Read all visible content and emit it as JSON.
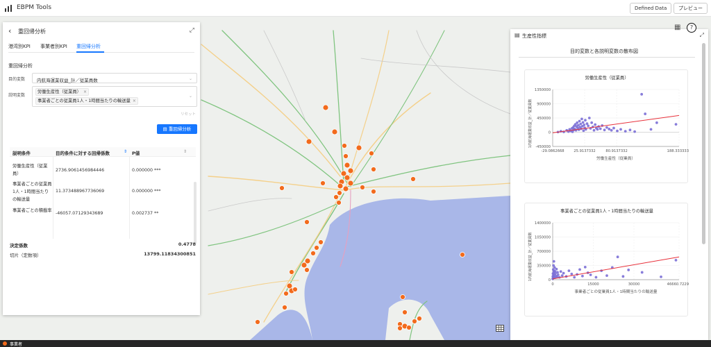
{
  "header": {
    "app_title": "EBPM Tools",
    "defined_data_label": "Defined Data",
    "preview_label": "プレビュー"
  },
  "left_panel": {
    "title": "重回帰分析",
    "tabs": [
      {
        "label": "港湾別KPI"
      },
      {
        "label": "事業者別KPI"
      },
      {
        "label": "重回帰分析"
      }
    ],
    "active_tab": "重回帰分析",
    "section_title": "重回帰分析",
    "objective_label": "目的変数",
    "objective_value": "内航海運業収益_計／従業員数",
    "explanatory_label": "説明変数",
    "explanatory_tags": [
      {
        "text": "労働生産性（従業員）"
      },
      {
        "text": "事業者ごとの従業員1人・1時間当たりの輸送量"
      }
    ],
    "reset_label": "リセット",
    "run_button_label": "重回帰分析",
    "table": {
      "headers": [
        "説明条件",
        "目的条件に対する回帰係数",
        "P値"
      ],
      "rows": [
        {
          "name": "労働生産性（従業員）",
          "coef": "2736.9061456984446",
          "p": "0.000000 ***"
        },
        {
          "name": "事業者ごとの従業員1人・1時間当たりの輸送量",
          "coef": "11.373488967736069",
          "p": "0.000000 ***"
        },
        {
          "name": "事業者ごとの積載率",
          "coef": "-46057.07129343689",
          "p": "0.002737 **"
        }
      ],
      "r2_label": "決定係数",
      "r2_value": "0.4778",
      "intercept_label": "切片（定数項）",
      "intercept_value": "13799.11834300851"
    }
  },
  "right_panel": {
    "title": "生産性指標",
    "subtitle": "目的変数と各説明変数の散布図"
  },
  "chart_data": [
    {
      "type": "scatter",
      "title": "労働生産性（従業員）",
      "xlabel": "労働生産性（従業員）",
      "ylabel": "1内航海運業収益_計／従業員数",
      "xticks": [
        "-29.0862668",
        "25.9137332",
        "80.9137332",
        "188.3333333"
      ],
      "yticks": [
        "1350000",
        "900000",
        "450000",
        "0",
        "-450000"
      ],
      "xlim": [
        -29.0862668,
        188.3333333
      ],
      "ylim": [
        -450000,
        1350000
      ],
      "point_color": "#7b6fd6",
      "line_color": "#e8303a",
      "regression": {
        "x": [
          -29.0862668,
          188.3333333
        ],
        "y": [
          -20000,
          530000
        ]
      },
      "points": [
        {
          "x": -20,
          "y": 5000
        },
        {
          "x": -15,
          "y": 30000
        },
        {
          "x": -10,
          "y": 10000
        },
        {
          "x": -5,
          "y": 60000
        },
        {
          "x": -2,
          "y": 20000
        },
        {
          "x": 0,
          "y": 90000
        },
        {
          "x": 2,
          "y": 40000
        },
        {
          "x": 4,
          "y": 120000
        },
        {
          "x": 5,
          "y": 15000
        },
        {
          "x": 6,
          "y": 150000
        },
        {
          "x": 7,
          "y": 70000
        },
        {
          "x": 8,
          "y": 200000
        },
        {
          "x": 9,
          "y": 100000
        },
        {
          "x": 10,
          "y": 250000
        },
        {
          "x": 11,
          "y": 60000
        },
        {
          "x": 12,
          "y": 180000
        },
        {
          "x": 13,
          "y": 300000
        },
        {
          "x": 14,
          "y": 130000
        },
        {
          "x": 15,
          "y": 220000
        },
        {
          "x": 16,
          "y": 80000
        },
        {
          "x": 17,
          "y": 350000
        },
        {
          "x": 18,
          "y": 160000
        },
        {
          "x": 19,
          "y": 260000
        },
        {
          "x": 20,
          "y": 110000
        },
        {
          "x": 21,
          "y": 420000
        },
        {
          "x": 22,
          "y": 190000
        },
        {
          "x": 23,
          "y": 310000
        },
        {
          "x": 24,
          "y": 50000
        },
        {
          "x": 25,
          "y": 230000
        },
        {
          "x": 26,
          "y": 140000
        },
        {
          "x": 27,
          "y": 380000
        },
        {
          "x": 28,
          "y": 90000
        },
        {
          "x": 30,
          "y": 270000
        },
        {
          "x": 32,
          "y": 200000
        },
        {
          "x": 34,
          "y": 450000
        },
        {
          "x": 36,
          "y": 120000
        },
        {
          "x": 38,
          "y": 300000
        },
        {
          "x": 40,
          "y": 170000
        },
        {
          "x": 42,
          "y": 60000
        },
        {
          "x": 44,
          "y": 240000
        },
        {
          "x": 46,
          "y": 130000
        },
        {
          "x": 48,
          "y": 90000
        },
        {
          "x": 50,
          "y": 180000
        },
        {
          "x": 53,
          "y": 110000
        },
        {
          "x": 56,
          "y": 210000
        },
        {
          "x": 60,
          "y": 70000
        },
        {
          "x": 64,
          "y": 150000
        },
        {
          "x": 68,
          "y": 100000
        },
        {
          "x": 72,
          "y": 60000
        },
        {
          "x": 76,
          "y": 130000
        },
        {
          "x": 82,
          "y": 40000
        },
        {
          "x": 88,
          "y": 90000
        },
        {
          "x": 96,
          "y": 30000
        },
        {
          "x": 104,
          "y": 70000
        },
        {
          "x": 112,
          "y": 20000
        },
        {
          "x": 124,
          "y": 1200000
        },
        {
          "x": 130,
          "y": 580000
        },
        {
          "x": 140,
          "y": 90000
        },
        {
          "x": 150,
          "y": 300000
        },
        {
          "x": 183,
          "y": 250000
        }
      ]
    },
    {
      "type": "scatter",
      "title": "事業者ごとの従業員1人・1時間当たりの輸送量",
      "xlabel": "事業者ごとの従業員1人・1時間当たりの輸送量",
      "ylabel": "1内航海運業収益_計／従業員数",
      "xticks": [
        "0",
        "15000",
        "30000",
        "46660.72292"
      ],
      "yticks": [
        "1400000",
        "1050000",
        "700000",
        "350000",
        "0"
      ],
      "xlim": [
        0,
        46660.72292
      ],
      "ylim": [
        0,
        1400000
      ],
      "point_color": "#7b6fd6",
      "line_color": "#e8303a",
      "regression": {
        "x": [
          0,
          46660.72292
        ],
        "y": [
          20000,
          560000
        ]
      },
      "points": [
        {
          "x": 0,
          "y": 20000
        },
        {
          "x": 60,
          "y": 80000
        },
        {
          "x": 100,
          "y": 150000
        },
        {
          "x": 150,
          "y": 40000
        },
        {
          "x": 200,
          "y": 250000
        },
        {
          "x": 250,
          "y": 100000
        },
        {
          "x": 300,
          "y": 350000
        },
        {
          "x": 350,
          "y": 180000
        },
        {
          "x": 400,
          "y": 60000
        },
        {
          "x": 450,
          "y": 450000
        },
        {
          "x": 500,
          "y": 220000
        },
        {
          "x": 600,
          "y": 120000
        },
        {
          "x": 700,
          "y": 300000
        },
        {
          "x": 800,
          "y": 50000
        },
        {
          "x": 900,
          "y": 200000
        },
        {
          "x": 1000,
          "y": 150000
        },
        {
          "x": 1200,
          "y": 90000
        },
        {
          "x": 1400,
          "y": 260000
        },
        {
          "x": 1600,
          "y": 70000
        },
        {
          "x": 1800,
          "y": 180000
        },
        {
          "x": 2000,
          "y": 120000
        },
        {
          "x": 2500,
          "y": 60000
        },
        {
          "x": 3000,
          "y": 200000
        },
        {
          "x": 3500,
          "y": 100000
        },
        {
          "x": 4000,
          "y": 160000
        },
        {
          "x": 5000,
          "y": 80000
        },
        {
          "x": 6000,
          "y": 220000
        },
        {
          "x": 7000,
          "y": 140000
        },
        {
          "x": 8000,
          "y": 60000
        },
        {
          "x": 9000,
          "y": 130000
        },
        {
          "x": 10000,
          "y": 250000
        },
        {
          "x": 11000,
          "y": 90000
        },
        {
          "x": 12000,
          "y": 310000
        },
        {
          "x": 13000,
          "y": 170000
        },
        {
          "x": 14000,
          "y": 120000
        },
        {
          "x": 16000,
          "y": 60000
        },
        {
          "x": 18000,
          "y": 220000
        },
        {
          "x": 20000,
          "y": 100000
        },
        {
          "x": 22000,
          "y": 300000
        },
        {
          "x": 24000,
          "y": 560000
        },
        {
          "x": 26000,
          "y": 80000
        },
        {
          "x": 28000,
          "y": 240000
        },
        {
          "x": 33000,
          "y": 180000
        },
        {
          "x": 40000,
          "y": 70000
        },
        {
          "x": 45500,
          "y": 480000
        }
      ]
    }
  ]
}
